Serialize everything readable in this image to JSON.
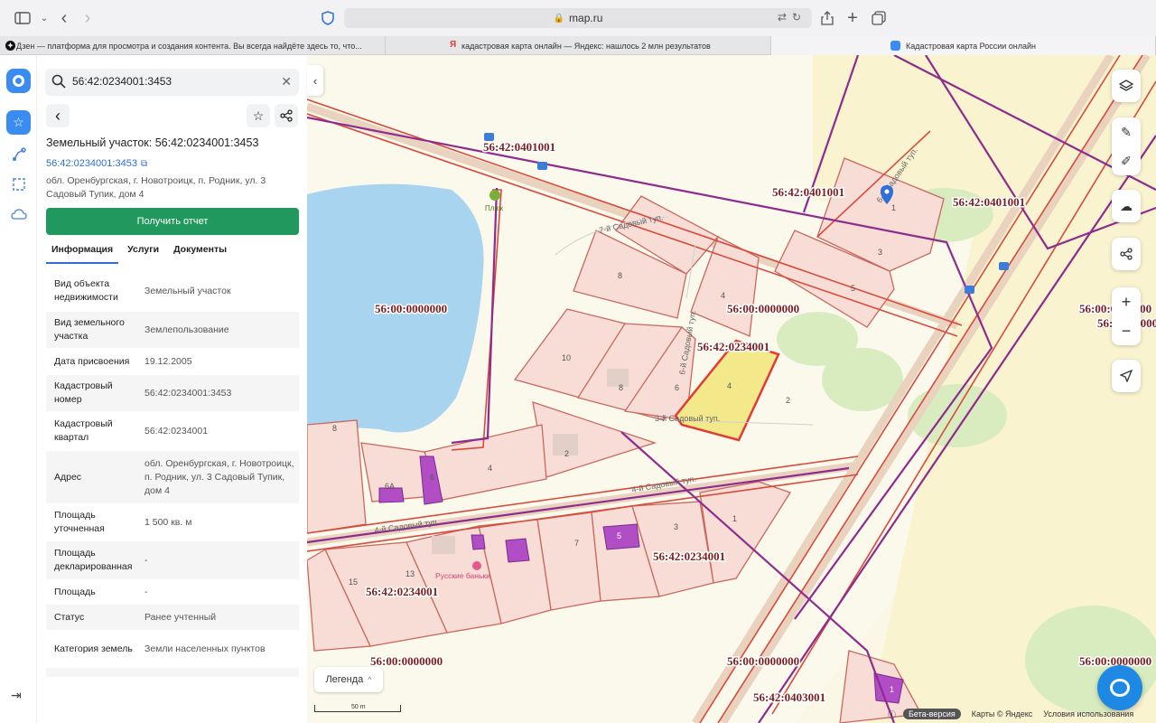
{
  "browser": {
    "url": "map.ru",
    "tabs": [
      {
        "label": "Дзен — платформа для просмотра и создания контента. Вы всегда найдёте здесь то, что...",
        "favicon": "dzen-icon"
      },
      {
        "label": "кадастровая карта онлайн — Яндекс: нашлось 2 млн результатов",
        "favicon": "yandex-icon"
      },
      {
        "label": "Кадастровая карта России онлайн",
        "favicon": "mapru-icon"
      }
    ]
  },
  "search": {
    "value": "56:42:0234001:3453"
  },
  "panel": {
    "title": "Земельный участок: 56:42:0234001:3453",
    "cadastral_link": "56:42:0234001:3453",
    "address": "обл. Оренбургская, г. Новотроицк, п. Родник, ул. 3 Садовый Тупик, дом 4",
    "report_button": "Получить отчет",
    "tabs": [
      "Информация",
      "Услуги",
      "Документы"
    ],
    "rows": [
      {
        "k": "Вид объекта недвижимости",
        "v": "Земельный участок"
      },
      {
        "k": "Вид земельного участка",
        "v": "Землепользование"
      },
      {
        "k": "Дата присвоения",
        "v": "19.12.2005"
      },
      {
        "k": "Кадастровый номер",
        "v": "56:42:0234001:3453"
      },
      {
        "k": "Кадастровый квартал",
        "v": "56:42:0234001"
      },
      {
        "k": "Адрес",
        "v": "обл. Оренбургская, г. Новотроицк, п. Родник, ул. 3 Садовый Тупик, дом 4"
      },
      {
        "k": "Площадь уточненная",
        "v": "1 500 кв. м"
      },
      {
        "k": "Площадь декларированная",
        "v": "-"
      },
      {
        "k": "Площадь",
        "v": "-"
      },
      {
        "k": "Статус",
        "v": "Ранее учтенный"
      },
      {
        "k": "Категория земель",
        "v": "Земли населенных пунктов"
      }
    ]
  },
  "map": {
    "labels": {
      "q0401001_a": "56:42:0401001",
      "q0401001_b": "56:42:0401001",
      "q0401001_c": "56:42:0401001",
      "q0000000_a": "56:00:0000000",
      "q0000000_b": "56:00:0000000",
      "q0000000_c": "56:00:0000000",
      "q0000000_d": "56:00:0000000",
      "q0000000_e": "56:00:0000000",
      "q0000000_f": "56:00:0000000",
      "q0234001_a": "56:42:0234001",
      "q0234001_b": "56:42:0234001",
      "q0234001_c": "56:42:0234001",
      "q0403001": "56:42:0403001"
    },
    "streets": {
      "s7": "7-й Садовый туп.",
      "s6": "6-й Садовый туп.",
      "s6b": "6-й Садовый туп.",
      "s4": "4-й Садовый туп.",
      "s3": "3-й Садовый туп.",
      "s2": "2-й Садовый туп."
    },
    "poi": {
      "beach": "Пляж",
      "banya": "Русские баньки"
    },
    "plots": [
      "1",
      "3",
      "5",
      "8",
      "4",
      "10",
      "8",
      "6",
      "4",
      "2",
      "8",
      "6А",
      "6",
      "4",
      "2",
      "1",
      "3",
      "7",
      "5",
      "15",
      "13",
      "1"
    ],
    "legend": "Легенда",
    "scale": "50 m",
    "beta": "Бета-версия",
    "attribution": "Карты © Яндекс",
    "terms": "Условия использования"
  },
  "colors": {
    "accent": "#3b8cf0",
    "report_button": "#21985e",
    "link": "#2f6fd6",
    "parcel_fill": "#f7ddd5",
    "parcel_stroke": "#c9685f",
    "selected_fill": "#f4e98a",
    "selected_stroke": "#e53935",
    "quarter_line": "#8e2c8e",
    "water": "#a8d4ef"
  }
}
